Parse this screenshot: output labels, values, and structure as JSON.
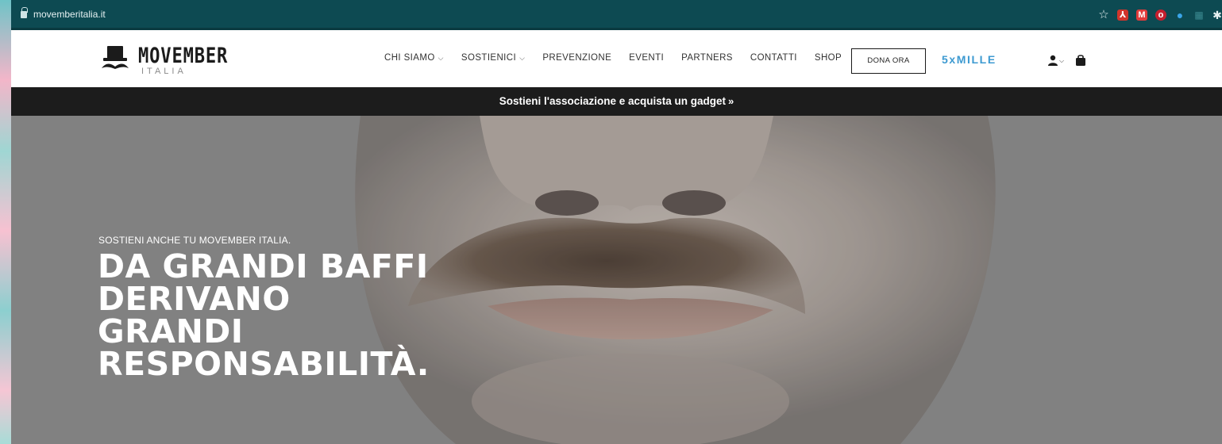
{
  "browser": {
    "url": "movemberitalia.it",
    "icons": [
      "lock-icon",
      "star-icon",
      "pdf-extension-icon",
      "m-extension-icon",
      "ublock-icon",
      "drop-extension-icon",
      "grid-extension-icon",
      "puzzle-icon"
    ]
  },
  "header": {
    "logo_word": "MOVEMBER",
    "logo_sub": "ITALIA",
    "nav": [
      {
        "label": "CHI SIAMO",
        "has_dropdown": true
      },
      {
        "label": "SOSTIENICI",
        "has_dropdown": true
      },
      {
        "label": "PREVENZIONE",
        "has_dropdown": false
      },
      {
        "label": "EVENTI",
        "has_dropdown": false
      },
      {
        "label": "PARTNERS",
        "has_dropdown": false
      },
      {
        "label": "CONTATTI",
        "has_dropdown": false
      },
      {
        "label": "SHOP",
        "has_dropdown": false
      }
    ],
    "donate_label": "DONA ORA",
    "five_mille_label": "5xMILLE",
    "accent_color": "#3d9ad1"
  },
  "promo": {
    "text": "Sostieni l'associazione e acquista un gadget",
    "arrow": "»"
  },
  "hero": {
    "kicker": "SOSTIENI ANCHE TU MOVEMBER ITALIA.",
    "headline_lines": [
      "DA GRANDI BAFFI",
      "DERIVANO",
      "GRANDI",
      "RESPONSABILITÀ."
    ]
  },
  "colors": {
    "address_bar": "#0d4a52",
    "promo_bar": "#1c1c1c",
    "text_dark": "#1b1b1b"
  }
}
